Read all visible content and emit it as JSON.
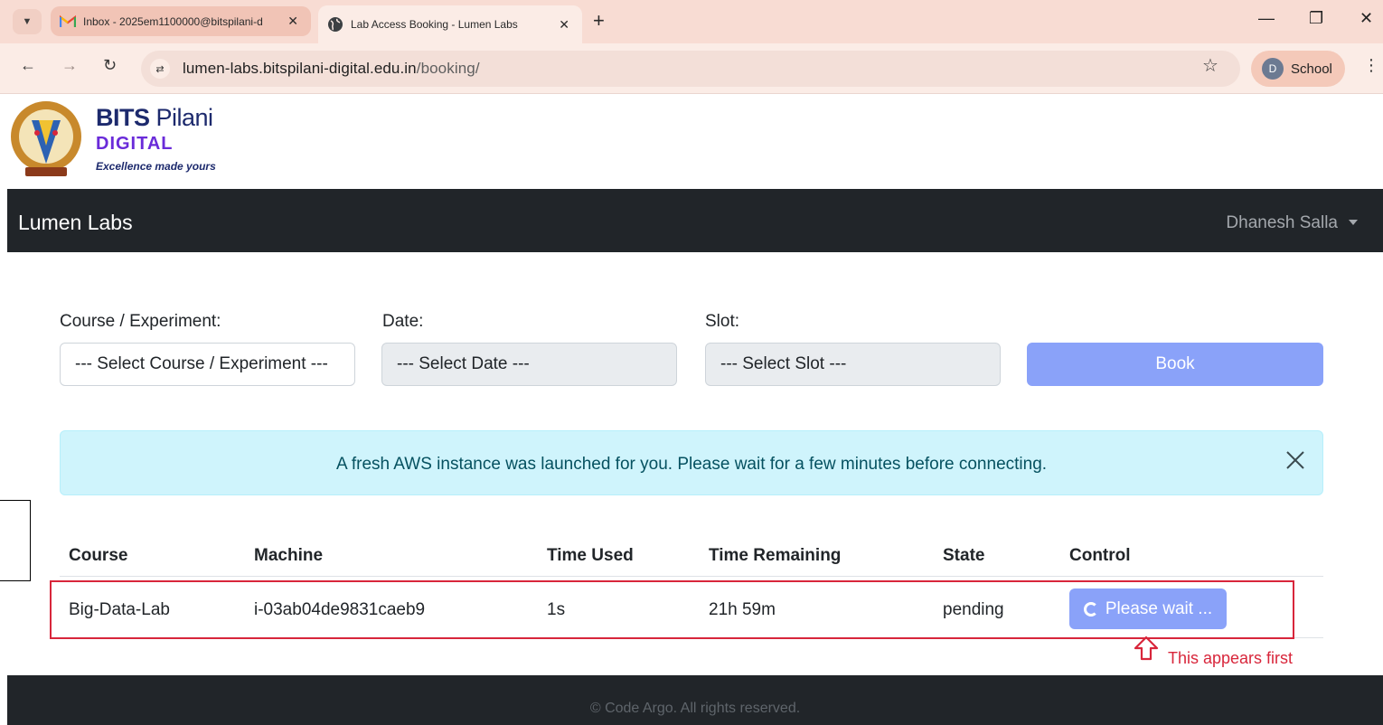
{
  "browser": {
    "tabs": [
      {
        "title": "Inbox - 2025em1100000@bitspilani-d",
        "icon": "gmail-icon",
        "active": false
      },
      {
        "title": "Lab Access Booking - Lumen Labs",
        "icon": "globe-icon",
        "active": true
      }
    ],
    "url_host": "lumen-labs.bitspilani-digital.edu.in",
    "url_path": "/booking/",
    "profile_initial": "D",
    "profile_name": "School"
  },
  "brand": {
    "line1_bold": "BITS",
    "line1_light": " Pilani",
    "line2": "DIGITAL",
    "tagline": "Excellence made yours"
  },
  "navbar": {
    "app_name": "Lumen Labs",
    "user_name": "Dhanesh Salla"
  },
  "booking_form": {
    "course_label": "Course / Experiment:",
    "course_value": "--- Select Course / Experiment ---",
    "date_label": "Date:",
    "date_value": "--- Select Date ---",
    "slot_label": "Slot:",
    "slot_value": "--- Select Slot ---",
    "book_label": "Book"
  },
  "alert": {
    "message": "A fresh AWS instance was launched for you. Please wait for a few minutes before connecting."
  },
  "table": {
    "headers": [
      "Course",
      "Machine",
      "Time Used",
      "Time Remaining",
      "State",
      "Control"
    ],
    "rows": [
      {
        "course": "Big-Data-Lab",
        "machine": "i-03ab04de9831caeb9",
        "time_used": "1s",
        "time_remaining": "21h 59m",
        "state": "pending",
        "control": "Please wait ..."
      }
    ]
  },
  "annotation": {
    "text": "This appears first",
    "color": "#d8263b"
  },
  "footer": {
    "text": "© Code Argo. All rights reserved."
  },
  "colors": {
    "navbar_bg": "#212529",
    "primary_disabled": "#8aa2f9",
    "alert_bg": "#cff4fc",
    "alert_text": "#055160"
  }
}
